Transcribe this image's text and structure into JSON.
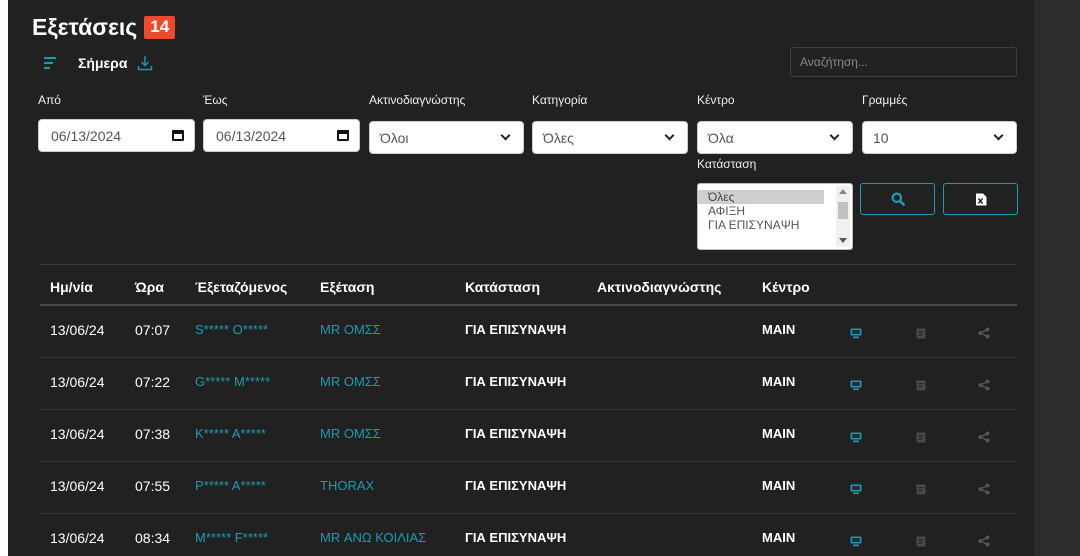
{
  "header": {
    "title": "Εξετάσεις",
    "count": "14"
  },
  "toolbar": {
    "today_label": "Σήμερα"
  },
  "search": {
    "placeholder": "Αναζήτηση..."
  },
  "filters": {
    "from_label": "Από",
    "from_value": "06/13/2024",
    "to_label": "Έως",
    "to_value": "06/13/2024",
    "radiologist_label": "Ακτινοδιαγνώστης",
    "radiologist_value": "Όλοι",
    "category_label": "Κατηγορία",
    "category_value": "Όλες",
    "center_label": "Κέντρο",
    "center_value": "Όλα",
    "rows_label": "Γραμμές",
    "rows_value": "10",
    "status_label": "Κατάσταση",
    "status_options": [
      "Όλες",
      "ΑΦΙΞΗ",
      "ΓΙΑ ΕΠΙΣΥΝΑΨΗ"
    ]
  },
  "table": {
    "columns": [
      "Ημ/νία",
      "Ώρα",
      "Έξεταζόμενος",
      "Εξέταση",
      "Κατάσταση",
      "Ακτινοδιαγνώστης",
      "Κέντρο"
    ],
    "rows": [
      {
        "date": "13/06/24",
        "time": "07:07",
        "patient": "S***** O*****",
        "exam": "MR ΟΜΣΣ",
        "status": "ΓΙΑ ΕΠΙΣΥΝΑΨΗ",
        "radiologist": "",
        "center": "MAIN"
      },
      {
        "date": "13/06/24",
        "time": "07:22",
        "patient": "G***** M*****",
        "exam": "MR ΟΜΣΣ",
        "status": "ΓΙΑ ΕΠΙΣΥΝΑΨΗ",
        "radiologist": "",
        "center": "MAIN"
      },
      {
        "date": "13/06/24",
        "time": "07:38",
        "patient": "K***** A*****",
        "exam": "MR ΟΜΣΣ",
        "status": "ΓΙΑ ΕΠΙΣΥΝΑΨΗ",
        "radiologist": "",
        "center": "MAIN"
      },
      {
        "date": "13/06/24",
        "time": "07:55",
        "patient": "P***** A*****",
        "exam": "THORAX",
        "status": "ΓΙΑ ΕΠΙΣΥΝΑΨΗ",
        "radiologist": "",
        "center": "MAIN"
      },
      {
        "date": "13/06/24",
        "time": "08:34",
        "patient": "M***** F*****",
        "exam": "MR ΑΝΩ ΚΟΙΛΙΑΣ",
        "status": "ΓΙΑ ΕΠΙΣΥΝΑΨΗ",
        "radiologist": "",
        "center": "MAIN"
      }
    ]
  },
  "icons": {
    "filter": "filter-lines-icon",
    "download": "download-icon",
    "calendar": "calendar-icon",
    "search": "search-icon",
    "excel": "excel-export-icon",
    "viewer": "monitor-icon",
    "report": "report-document-icon",
    "share": "share-icon"
  },
  "colors": {
    "accent": "#1d9bb4",
    "badge": "#f04a2c",
    "background": "#212121"
  }
}
